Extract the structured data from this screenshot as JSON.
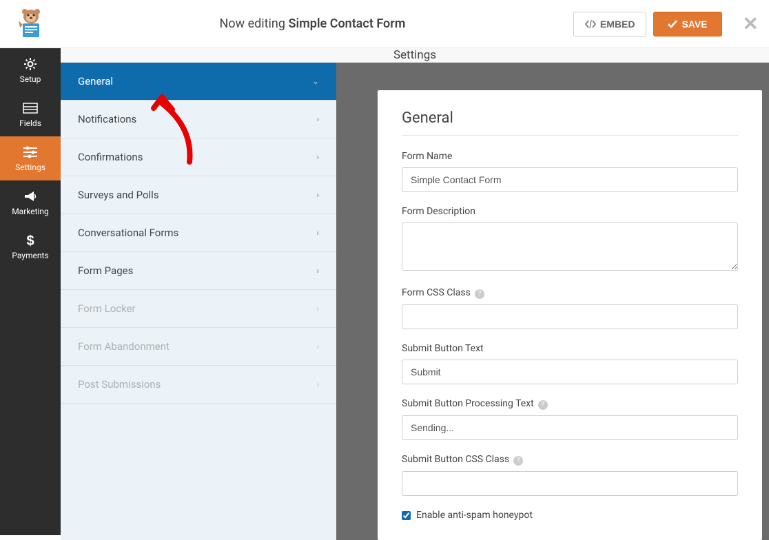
{
  "header": {
    "editing_prefix": "Now editing ",
    "form_title": "Simple Contact Form",
    "embed_label": "EMBED",
    "save_label": "SAVE"
  },
  "leftnav": {
    "items": [
      {
        "label": "Setup",
        "icon": "gear"
      },
      {
        "label": "Fields",
        "icon": "list"
      },
      {
        "label": "Settings",
        "icon": "sliders"
      },
      {
        "label": "Marketing",
        "icon": "bullhorn"
      },
      {
        "label": "Payments",
        "icon": "dollar"
      }
    ],
    "active_index": 2
  },
  "section_title": "Settings",
  "sub_sidebar": {
    "items": [
      {
        "label": "General",
        "state": "active",
        "arrow": "down"
      },
      {
        "label": "Notifications",
        "state": "normal",
        "arrow": "right"
      },
      {
        "label": "Confirmations",
        "state": "normal",
        "arrow": "right"
      },
      {
        "label": "Surveys and Polls",
        "state": "normal",
        "arrow": "right"
      },
      {
        "label": "Conversational Forms",
        "state": "normal",
        "arrow": "right"
      },
      {
        "label": "Form Pages",
        "state": "normal",
        "arrow": "right"
      },
      {
        "label": "Form Locker",
        "state": "disabled",
        "arrow": "right"
      },
      {
        "label": "Form Abandonment",
        "state": "disabled",
        "arrow": "right"
      },
      {
        "label": "Post Submissions",
        "state": "disabled",
        "arrow": "right"
      }
    ]
  },
  "panel": {
    "heading": "General",
    "form_name_label": "Form Name",
    "form_name_value": "Simple Contact Form",
    "form_description_label": "Form Description",
    "form_description_value": "",
    "form_css_class_label": "Form CSS Class",
    "form_css_class_value": "",
    "submit_text_label": "Submit Button Text",
    "submit_text_value": "Submit",
    "submit_processing_label": "Submit Button Processing Text",
    "submit_processing_value": "Sending...",
    "submit_css_label": "Submit Button CSS Class",
    "submit_css_value": "",
    "honeypot_label": "Enable anti-spam honeypot",
    "honeypot_checked": true
  }
}
